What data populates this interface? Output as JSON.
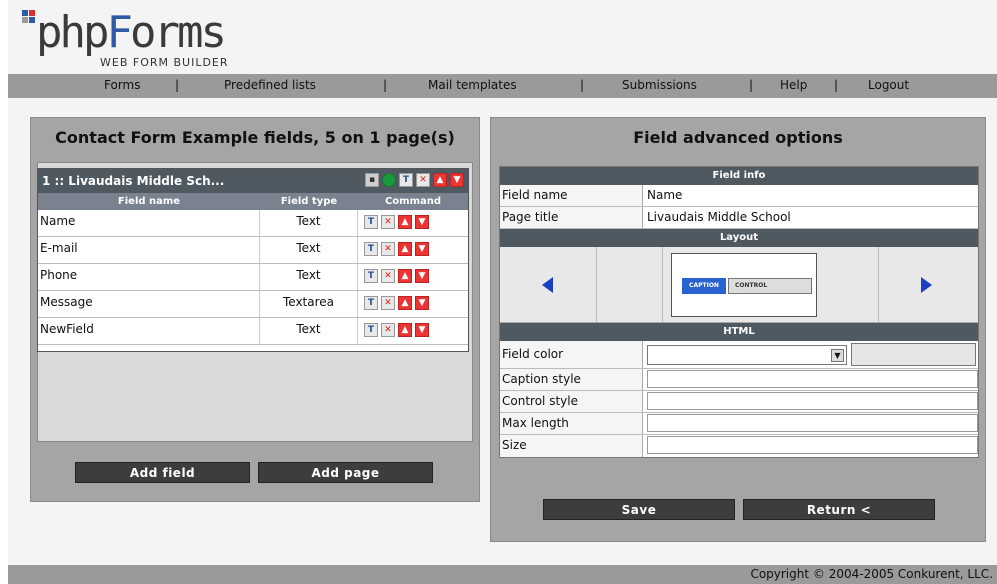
{
  "header": {
    "logo_text_main": "phpForms",
    "logo_text_sub": "WEB FORM BUILDER",
    "logo_colors": {
      "red": "#d83030",
      "blue": "#2f5aa8",
      "grey": "#9a9a9a"
    }
  },
  "menu": {
    "items": [
      {
        "label": "Forms"
      },
      {
        "label": "Predefined lists"
      },
      {
        "label": "Mail templates"
      },
      {
        "label": "Submissions"
      },
      {
        "label": "Help"
      },
      {
        "label": "Logout"
      }
    ],
    "separator": "|"
  },
  "left": {
    "title": "Contact Form Example fields, 5 on 1 page(s)",
    "page": {
      "title": "1 :: Livaudais Middle Sch...",
      "columns": [
        "Field name",
        "Field type",
        "Command"
      ],
      "rows": [
        {
          "name": "Name",
          "type": "Text"
        },
        {
          "name": "E-mail",
          "type": "Text"
        },
        {
          "name": "Phone",
          "type": "Text"
        },
        {
          "name": "Message",
          "type": "Textarea"
        },
        {
          "name": "NewField",
          "type": "Text"
        }
      ]
    },
    "add_field": "Add field",
    "add_page": "Add page"
  },
  "right": {
    "title": "Field advanced options",
    "field_info_head": "Field info",
    "field_name_label": "Field name",
    "field_name_value": "Name",
    "page_title_label": "Page title",
    "page_title_value": "Livaudais Middle School",
    "layout_head": "Layout",
    "preview_caption": "CAPTION",
    "preview_control": "CONTROL",
    "html_head": "HTML",
    "field_color_label": "Field color",
    "caption_style_label": "Caption style",
    "control_style_label": "Control style",
    "max_length_label": "Max length",
    "size_label": "Size",
    "save": "Save",
    "return": "Return <"
  },
  "footer": {
    "copyright": "Copyright © 2004-2005 Conkurent, LLC."
  },
  "colors": {
    "section_head": "#4f5961",
    "panel": "#a5a5a5",
    "accent_blue": "#2a62d0",
    "arrow_blue": "#1a3fc0",
    "command_red": "#e33333"
  }
}
